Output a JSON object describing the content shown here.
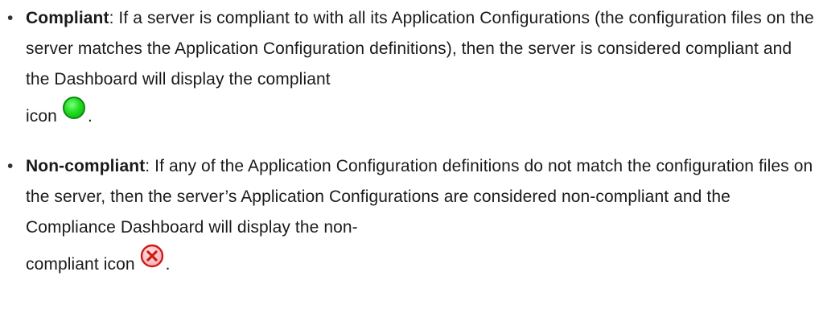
{
  "items": [
    {
      "term": "Compliant",
      "body_line": ": If a server is compliant to with all its Application Configurations (the configuration files on the server matches the Application Configuration definitions), then the server is considered compliant and the Dashboard will display the compliant",
      "tail": "icon",
      "end": ".",
      "icon": "green-circle-icon",
      "icon_color": "#22dd22"
    },
    {
      "term": "Non-compliant",
      "body_line": ": If any of the Application Configuration definitions do not match the configuration files on the server, then the server’s Application Configurations are considered non-compliant and the Compliance Dashboard will display the non-",
      "tail": "compliant icon",
      "end": ".",
      "icon": "red-x-circle-icon",
      "icon_color": "#e02020"
    }
  ]
}
